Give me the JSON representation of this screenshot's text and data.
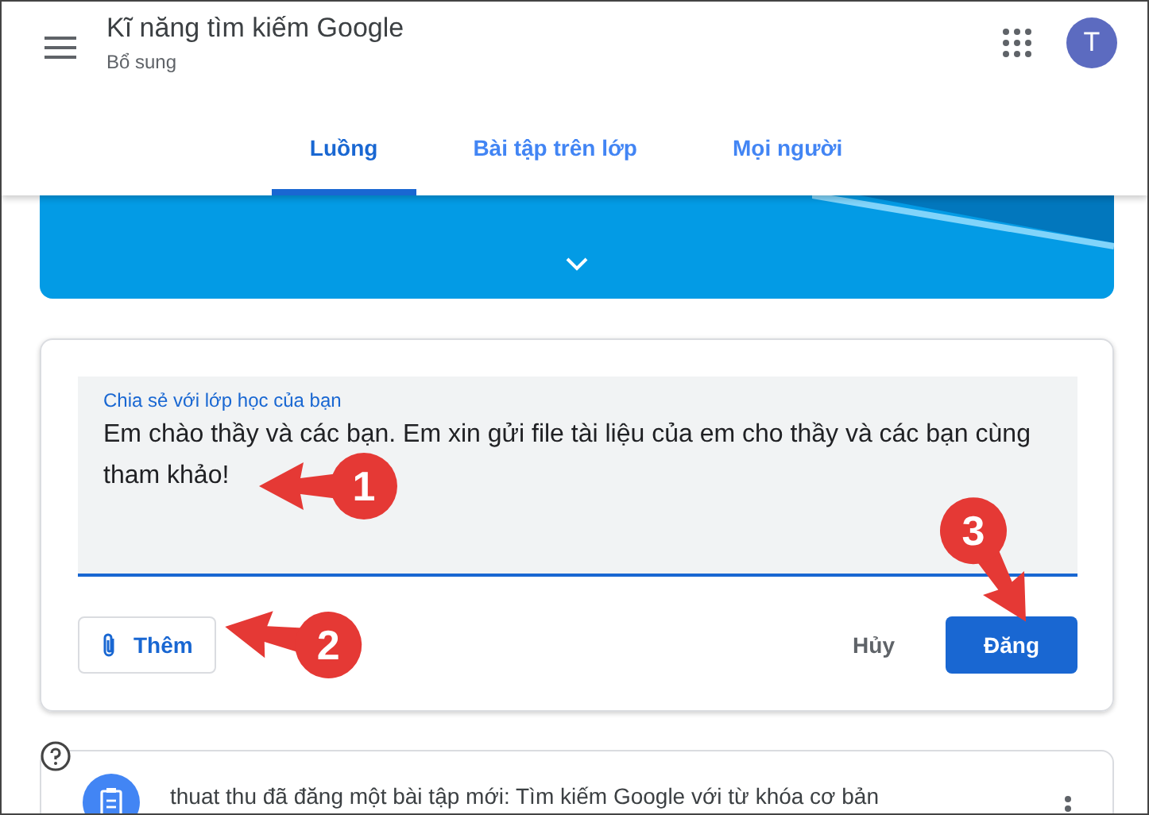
{
  "header": {
    "title": "Kĩ năng tìm kiếm Google",
    "subtitle": "Bổ sung",
    "avatar": "T"
  },
  "tabs": [
    {
      "label": "Luồng",
      "selected": true
    },
    {
      "label": "Bài tập trên lớp",
      "selected": false
    },
    {
      "label": "Mọi người",
      "selected": false
    }
  ],
  "compose": {
    "label": "Chia sẻ với lớp học của bạn",
    "value": "Em chào thầy và các bạn. Em xin gửi file tài liệu của em cho thầy và các bạn cùng tham khảo!",
    "add_button": "Thêm",
    "cancel_button": "Hủy",
    "post_button": "Đăng"
  },
  "post": {
    "text": "thuat thu đã đăng một bài tập mới: Tìm kiếm Google với từ khóa cơ bản"
  },
  "annotations": [
    {
      "label": "1"
    },
    {
      "label": "2"
    },
    {
      "label": "3"
    }
  ]
}
